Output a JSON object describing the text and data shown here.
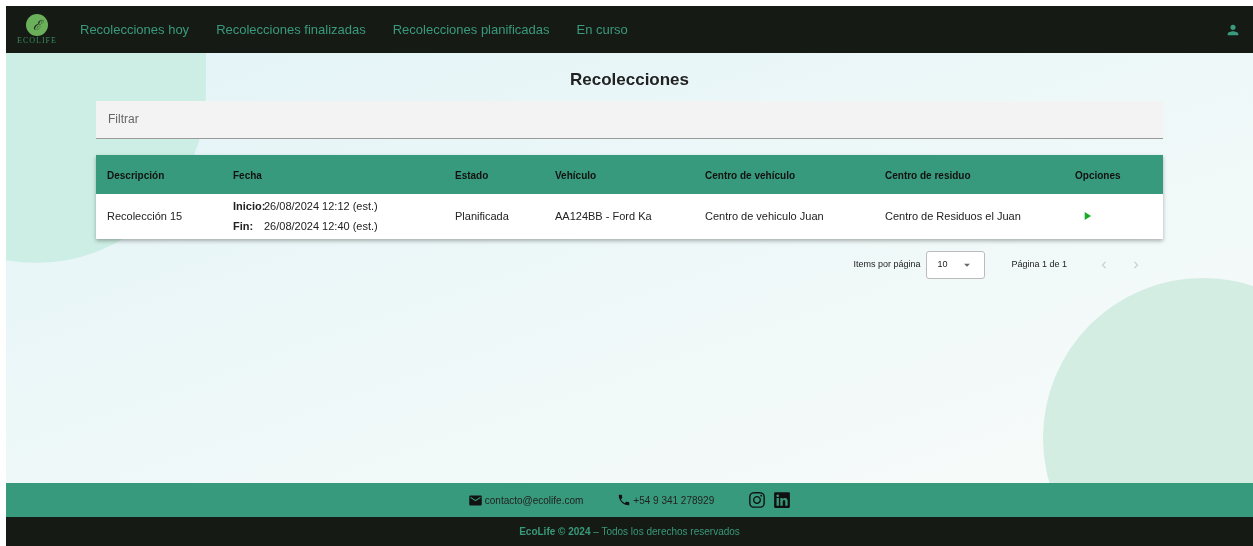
{
  "logo": {
    "mark": "ℰ",
    "name": "ECOLIFE"
  },
  "nav": [
    {
      "label": "Recolecciones hoy"
    },
    {
      "label": "Recolecciones finalizadas"
    },
    {
      "label": "Recolecciones planificadas"
    },
    {
      "label": "En curso"
    }
  ],
  "page_title": "Recolecciones",
  "filter": {
    "placeholder": "Filtrar"
  },
  "table": {
    "columns": [
      "Descripción",
      "Fecha",
      "Estado",
      "Vehículo",
      "Centro de vehículo",
      "Centro de residuo",
      "Opciones"
    ],
    "rows": [
      {
        "description": "Recolección 15",
        "start_label": "Inicio:",
        "start": "26/08/2024 12:12 (est.)",
        "end_label": "Fin:",
        "end": "26/08/2024 12:40 (est.)",
        "status": "Planificada",
        "vehicle": "AA124BB - Ford Ka",
        "vehicle_center": "Centro de vehiculo Juan",
        "waste_center": "Centro de Residuos el Juan"
      }
    ]
  },
  "pagination": {
    "items_label": "Items por página",
    "page_size": "10",
    "page_info": "Página 1 de 1"
  },
  "footer": {
    "email": "contacto@ecolife.com",
    "phone": "+54 9 341 278929",
    "copyright": "**EcoLife © 2024** – Todos los derechos reservados"
  }
}
